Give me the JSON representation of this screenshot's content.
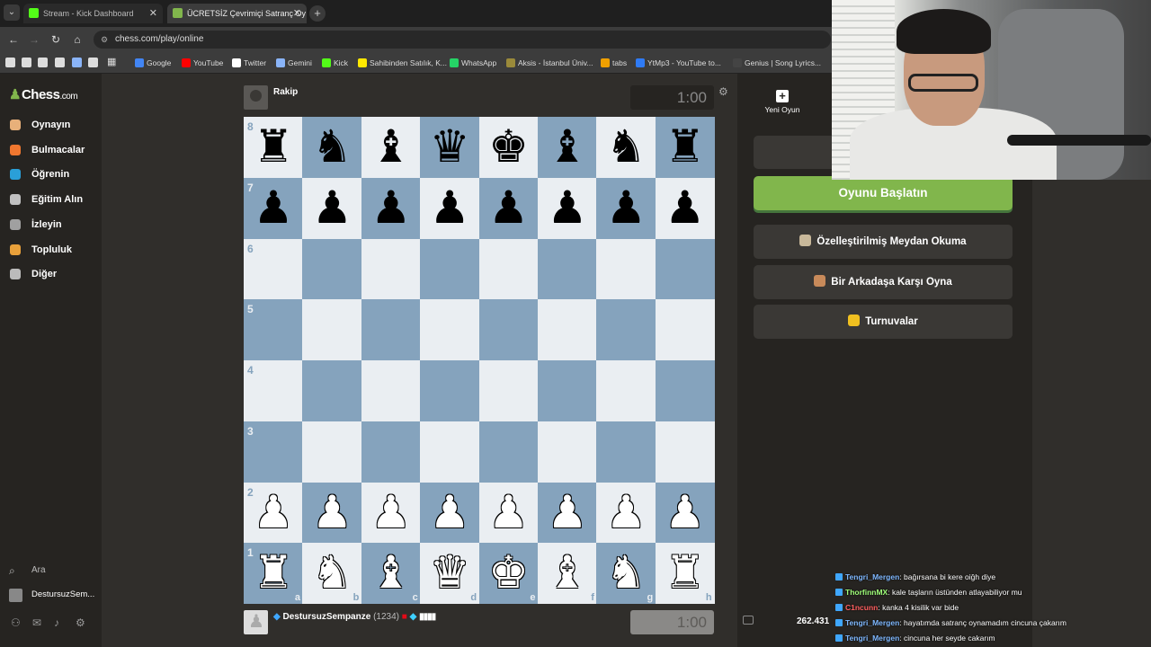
{
  "browser": {
    "tabs": [
      {
        "label": "Stream - Kick Dashboard"
      },
      {
        "label": "ÜCRETSİZ Çevrimiçi Satranç Oy"
      }
    ],
    "url": "chess.com/play/online",
    "bookmarks": [
      "Google",
      "YouTube",
      "Twitter",
      "Gemini",
      "Kick",
      "Sahibinden Satılık, K...",
      "WhatsApp",
      "Aksis - İstanbul Üniv...",
      "tabs",
      "YtMp3 - YouTube to...",
      "Genius | Song Lyrics..."
    ],
    "bookmark_colors": [
      "#4285f4",
      "#ff0000",
      "#ffffff",
      "#8ab4f8",
      "#53fc18",
      "#ffe800",
      "#25d366",
      "#9a8a3a",
      "#f0a000",
      "#2f7bf5",
      "#444444"
    ]
  },
  "sidebar": {
    "logo": "Chess",
    "logo_suffix": ".com",
    "items": [
      {
        "label": "Oynayın",
        "icon": "play-icon",
        "color": "#e8b07a"
      },
      {
        "label": "Bulmacalar",
        "icon": "puzzle-icon",
        "color": "#f0772f"
      },
      {
        "label": "Öğrenin",
        "icon": "learn-icon",
        "color": "#2a9fd8"
      },
      {
        "label": "Eğitim Alın",
        "icon": "train-icon",
        "color": "#c0c0c0"
      },
      {
        "label": "İzleyin",
        "icon": "binoculars-icon",
        "color": "#a0a0a0"
      },
      {
        "label": "Topluluk",
        "icon": "community-icon",
        "color": "#e8a03a"
      },
      {
        "label": "Diğer",
        "icon": "more-icon",
        "color": "#bbbbbb"
      }
    ],
    "search": "Ara",
    "username": "DestursuzSem..."
  },
  "game": {
    "opponent_name": "Rakip",
    "opponent_clock": "1:00",
    "player_name": "DestursuzSempanze",
    "player_rating": "(1234)",
    "player_clock": "1:00",
    "ranks": [
      "8",
      "7",
      "6",
      "5",
      "4",
      "3",
      "2",
      "1"
    ],
    "files": [
      "a",
      "b",
      "c",
      "d",
      "e",
      "f",
      "g",
      "h"
    ],
    "board": [
      [
        "r",
        "n",
        "b",
        "q",
        "k",
        "b",
        "n",
        "r"
      ],
      [
        "p",
        "p",
        "p",
        "p",
        "p",
        "p",
        "p",
        "p"
      ],
      [
        "",
        "",
        "",
        "",
        "",
        "",
        "",
        ""
      ],
      [
        "",
        "",
        "",
        "",
        "",
        "",
        "",
        ""
      ],
      [
        "",
        "",
        "",
        "",
        "",
        "",
        "",
        ""
      ],
      [
        "",
        "",
        "",
        "",
        "",
        "",
        "",
        ""
      ],
      [
        "P",
        "P",
        "P",
        "P",
        "P",
        "P",
        "P",
        "P"
      ],
      [
        "R",
        "N",
        "B",
        "Q",
        "K",
        "B",
        "N",
        "R"
      ]
    ]
  },
  "panel": {
    "new_game_label": "Yeni Oyun",
    "start_button": "Oyunu Başlatın",
    "options": [
      {
        "label": "Özelleştirilmiş Meydan Okuma",
        "icon": "challenge-icon",
        "color": "#c8b89a"
      },
      {
        "label": "Bir Arkadaşa Karşı Oyna",
        "icon": "handshake-icon",
        "color": "#c88a5a"
      },
      {
        "label": "Turnuvalar",
        "icon": "trophy-icon",
        "color": "#f0c020"
      }
    ]
  },
  "stream": {
    "viewers": "262.431",
    "chat": [
      {
        "user": "Tengri_Mergen",
        "text": ": bağırsana bi kere oiğh diye",
        "color": "#7fb8ff"
      },
      {
        "user": "ThorfinnMX",
        "text": ": kale taşların üstünden atlayabiliyor mu",
        "color": "#a0ff7a"
      },
      {
        "user": "C1ncunn",
        "text": ": kanka 4 kisilik var bide",
        "color": "#ff6060"
      },
      {
        "user": "Tengri_Mergen",
        "text": ": hayatımda satranç oynamadım cincuna çakarım",
        "color": "#7fb8ff"
      },
      {
        "user": "Tengri_Mergen",
        "text": ": cincuna her seyde cakarım",
        "color": "#7fb8ff"
      }
    ]
  }
}
